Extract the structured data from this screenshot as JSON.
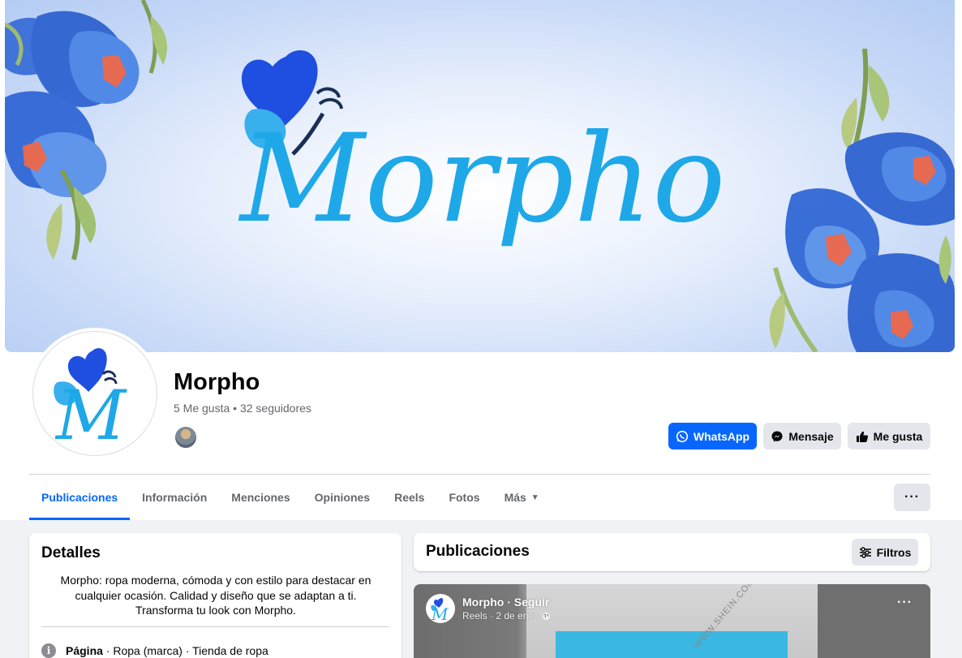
{
  "page": {
    "name": "Morpho",
    "stats": "5 Me gusta • 32 seguidores"
  },
  "cover": {
    "logo_text": "Morpho"
  },
  "actions": {
    "whatsapp": "WhatsApp",
    "message": "Mensaje",
    "like": "Me gusta",
    "more": "···"
  },
  "tabs": [
    {
      "label": "Publicaciones",
      "active": true
    },
    {
      "label": "Información"
    },
    {
      "label": "Menciones"
    },
    {
      "label": "Opiniones"
    },
    {
      "label": "Reels"
    },
    {
      "label": "Fotos"
    },
    {
      "label": "Más"
    }
  ],
  "details": {
    "title": "Detalles",
    "bio": "Morpho: ropa moderna, cómoda y con estilo para destacar en cualquier ocasión. Calidad y diseño que se adaptan a ti. Transforma tu look con Morpho.",
    "info_label": "Página",
    "info_rest": " · Ropa (marca) · Tienda de ropa"
  },
  "posts": {
    "title": "Publicaciones",
    "filter": "Filtros",
    "reel": {
      "title": "Morpho · Seguir",
      "subtitle": "Reels · 2 de ene ·",
      "watermark": "WWW.SHEIN.COM",
      "more": "···"
    }
  },
  "colors": {
    "accent": "#0866ff",
    "logo_dark": "#1f4fe0",
    "logo_light": "#1ea8e8"
  },
  "icons": [
    "whatsapp-icon",
    "messenger-icon",
    "thumbs-up-icon",
    "caret-down-icon",
    "filter-icon",
    "info-icon",
    "globe-icon"
  ]
}
